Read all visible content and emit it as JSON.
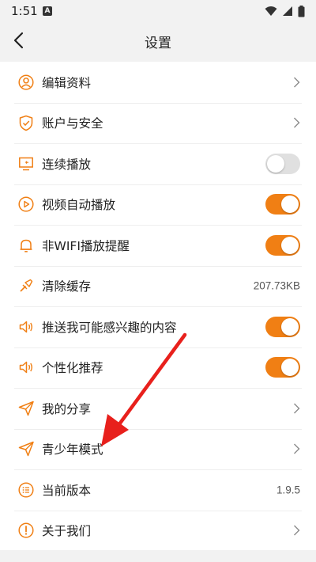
{
  "status_bar": {
    "time": "1:51",
    "notif_letter": "A"
  },
  "nav": {
    "title": "设置"
  },
  "items": [
    {
      "label": "编辑资料",
      "type": "chevron",
      "icon": "user-icon"
    },
    {
      "label": "账户与安全",
      "type": "chevron",
      "icon": "shield-icon"
    },
    {
      "label": "连续播放",
      "type": "toggle",
      "on": false,
      "icon": "screen-icon"
    },
    {
      "label": "视频自动播放",
      "type": "toggle",
      "on": true,
      "icon": "play-circle-icon"
    },
    {
      "label": "非WIFI播放提醒",
      "type": "toggle",
      "on": true,
      "icon": "bell-icon"
    },
    {
      "label": "清除缓存",
      "type": "value",
      "value": "207.73KB",
      "icon": "broom-icon"
    },
    {
      "label": "推送我可能感兴趣的内容",
      "type": "toggle",
      "on": true,
      "icon": "speaker-icon"
    },
    {
      "label": "个性化推荐",
      "type": "toggle",
      "on": true,
      "icon": "speaker-icon"
    },
    {
      "label": "我的分享",
      "type": "chevron",
      "icon": "paper-plane-icon"
    },
    {
      "label": "青少年模式",
      "type": "chevron",
      "icon": "paper-plane-icon"
    },
    {
      "label": "当前版本",
      "type": "value",
      "value": "1.9.5",
      "icon": "list-circle-icon"
    },
    {
      "label": "关于我们",
      "type": "chevron",
      "icon": "info-circle-icon"
    }
  ],
  "colors": {
    "accent": "#f07f14",
    "toggle_off": "#e0e0e0",
    "annotation_arrow": "#e8201c"
  }
}
